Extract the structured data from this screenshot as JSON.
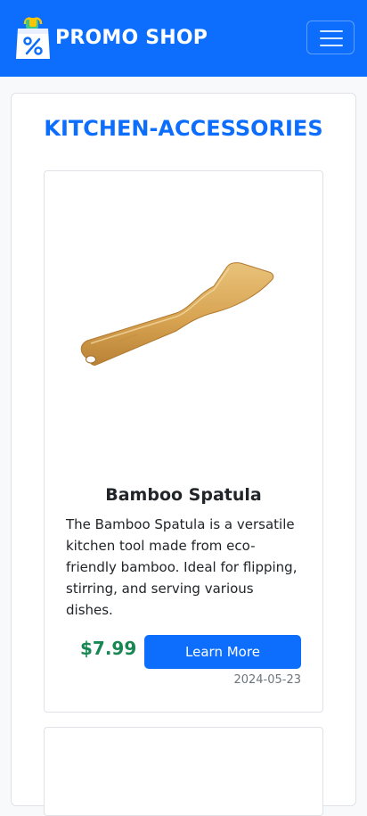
{
  "header": {
    "brand": "PROMO SHOP",
    "logo_icon": "shopping-bag-percent-icon",
    "menu_icon": "hamburger-menu-icon"
  },
  "category": {
    "title": "KITCHEN-ACCESSORIES"
  },
  "products": [
    {
      "name": "Bamboo Spatula",
      "image_icon": "bamboo-spatula-image",
      "description": "The Bamboo Spatula is a versatile kitchen tool made from eco-friendly bamboo. Ideal for flipping, stirring, and serving various dishes.",
      "price": "$7.99",
      "button_label": "Learn More",
      "date": "2024-05-23"
    }
  ],
  "colors": {
    "primary": "#0d6efd",
    "price": "#198754",
    "muted": "#6c757d",
    "text": "#212529"
  }
}
